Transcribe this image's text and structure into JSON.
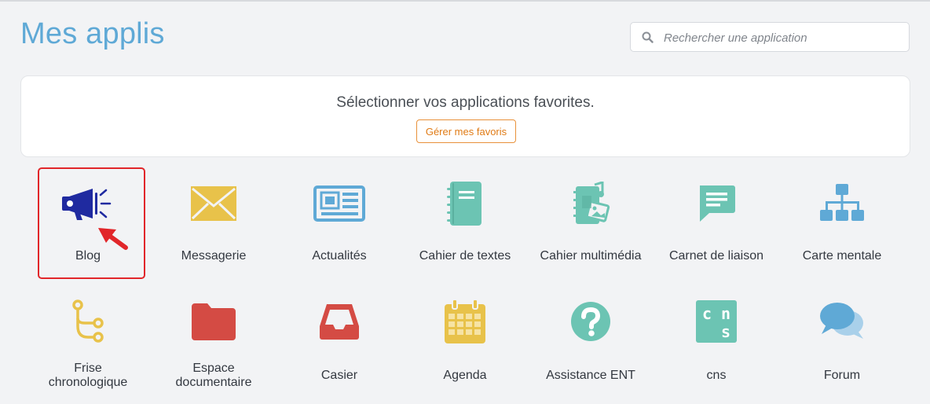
{
  "page": {
    "title": "Mes applis"
  },
  "search": {
    "placeholder": "Rechercher une application",
    "icon": "search-icon"
  },
  "favorites": {
    "message": "Sélectionner vos applications favorites.",
    "manage_button": "Gérer mes favoris",
    "accent": "#e07b16"
  },
  "apps": [
    {
      "label": "Blog",
      "icon": "megaphone-icon",
      "color": "#1f2aa0",
      "highlighted": true
    },
    {
      "label": "Messagerie",
      "icon": "envelope-icon",
      "color": "#e8c24a"
    },
    {
      "label": "Actualités",
      "icon": "newspaper-icon",
      "color": "#5fa9d6"
    },
    {
      "label": "Cahier de textes",
      "icon": "notebook-icon",
      "color": "#6cc4b3"
    },
    {
      "label": "Cahier multimédia",
      "icon": "multimedia-notebook-icon",
      "color": "#6cc4b3"
    },
    {
      "label": "Carnet de liaison",
      "icon": "chat-bubble-icon",
      "color": "#6cc4b3"
    },
    {
      "label": "Carte mentale",
      "icon": "sitemap-icon",
      "color": "#5fa9d6"
    },
    {
      "label_line1": "Frise",
      "label_line2": "chronologique",
      "icon": "timeline-icon",
      "color": "#e8c24a"
    },
    {
      "label_line1": "Espace",
      "label_line2": "documentaire",
      "icon": "folder-icon",
      "color": "#d44b44"
    },
    {
      "label": "Casier",
      "icon": "inbox-tray-icon",
      "color": "#d44b44"
    },
    {
      "label": "Agenda",
      "icon": "calendar-icon",
      "color": "#e8c24a"
    },
    {
      "label": "Assistance ENT",
      "icon": "question-circle-icon",
      "color": "#6cc4b3"
    },
    {
      "label": "cns",
      "icon": "cns-icon",
      "color": "#6cc4b3"
    },
    {
      "label": "Forum",
      "icon": "forum-bubbles-icon",
      "color": "#5fa9d6"
    }
  ]
}
